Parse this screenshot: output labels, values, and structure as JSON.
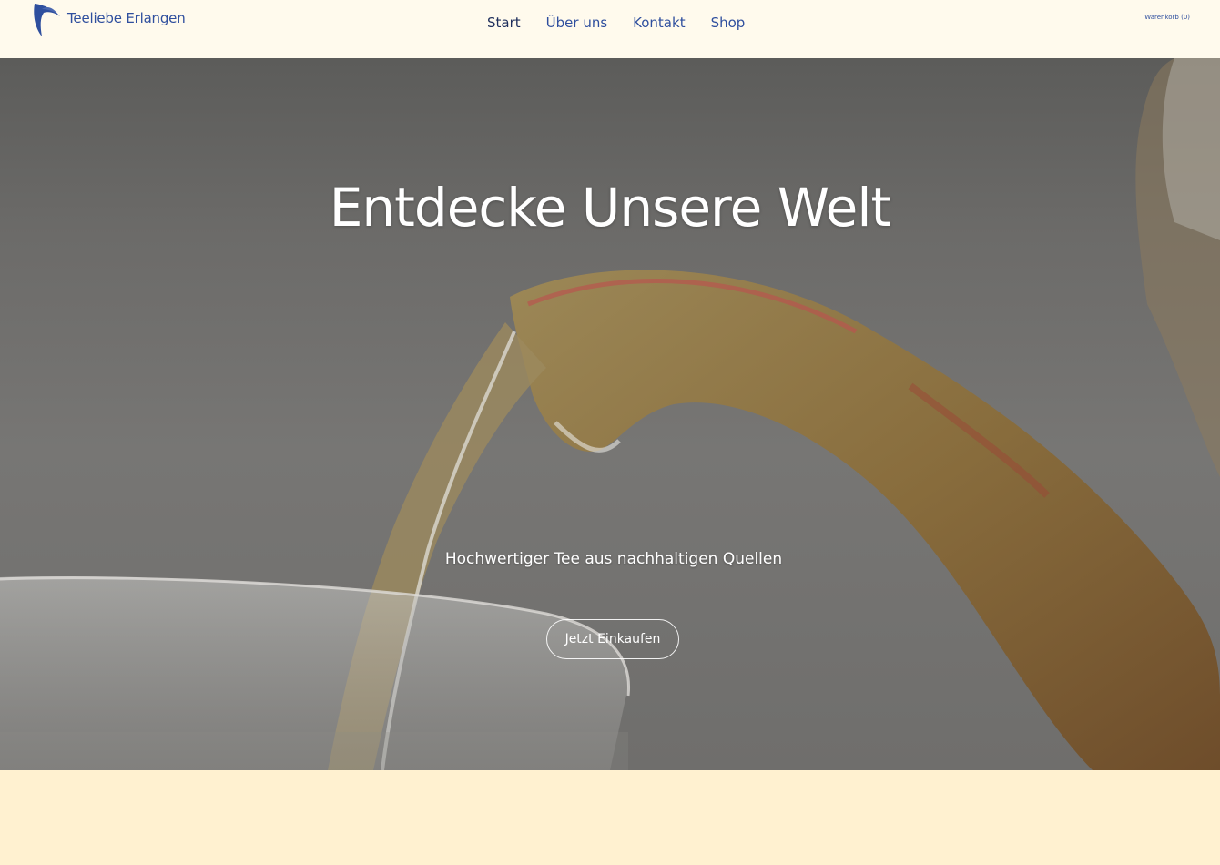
{
  "header": {
    "brand": "Teeliebe Erlangen",
    "nav": [
      {
        "label": "Start",
        "active": true
      },
      {
        "label": "Über uns",
        "active": false
      },
      {
        "label": "Kontakt",
        "active": false
      },
      {
        "label": "Shop",
        "active": false
      }
    ],
    "cart_label": "Warenkorb (0)"
  },
  "hero": {
    "title": "Entdecke Unsere Welt",
    "subtitle": "Hochwertiger Tee aus nachhaltigen Quellen",
    "cta_label": "Jetzt Einkaufen"
  },
  "colors": {
    "brand_blue": "#2f4f9e",
    "header_bg": "#fffaed",
    "page_bg": "#fff1d0"
  }
}
